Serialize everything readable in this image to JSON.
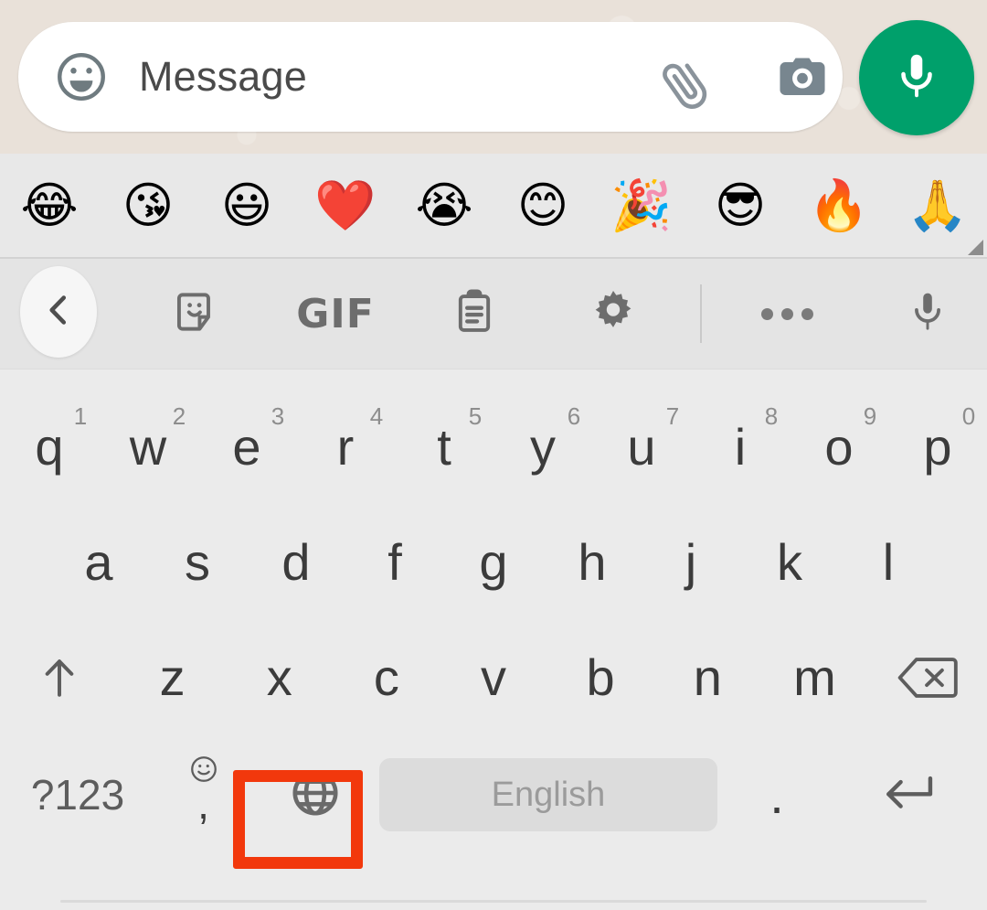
{
  "chat_input": {
    "emoji_icon": "smiley-face-icon",
    "placeholder": "Message",
    "attach_icon": "paperclip-icon",
    "camera_icon": "camera-icon",
    "voice_icon": "microphone-icon",
    "accent_green": "#00a06b",
    "background": "#e9e1d9"
  },
  "emoji_suggestions": {
    "items": [
      {
        "name": "face-with-tears-of-joy",
        "glyph": "😂"
      },
      {
        "name": "face-blowing-a-kiss",
        "glyph": "😘"
      },
      {
        "name": "grinning-face-with-big-eyes",
        "glyph": "😃"
      },
      {
        "name": "red-heart",
        "glyph": "❤️"
      },
      {
        "name": "loudly-crying-face",
        "glyph": "😭"
      },
      {
        "name": "smiling-face-with-smiling-eyes",
        "glyph": "😊"
      },
      {
        "name": "party-popper",
        "glyph": "🎉"
      },
      {
        "name": "smiling-face-with-sunglasses",
        "glyph": "😎"
      },
      {
        "name": "fire",
        "glyph": "🔥"
      },
      {
        "name": "folded-hands",
        "glyph": "🙏"
      }
    ],
    "resize_handle": "resize-handle-icon",
    "background": "#e8e8e8"
  },
  "toolbar": {
    "back_icon": "chevron-left-icon",
    "items": [
      {
        "name": "sticker-icon",
        "label": ""
      },
      {
        "name": "gif-icon",
        "label": "GIF"
      },
      {
        "name": "clipboard-icon",
        "label": ""
      },
      {
        "name": "settings-gear-icon",
        "label": ""
      },
      {
        "name": "more-options-icon",
        "label": ""
      },
      {
        "name": "voice-input-icon",
        "label": ""
      }
    ],
    "background": "#e4e4e4"
  },
  "keyboard": {
    "background": "#ebebeb",
    "row1": [
      {
        "key": "q",
        "hint": "1"
      },
      {
        "key": "w",
        "hint": "2"
      },
      {
        "key": "e",
        "hint": "3"
      },
      {
        "key": "r",
        "hint": "4"
      },
      {
        "key": "t",
        "hint": "5"
      },
      {
        "key": "y",
        "hint": "6"
      },
      {
        "key": "u",
        "hint": "7"
      },
      {
        "key": "i",
        "hint": "8"
      },
      {
        "key": "o",
        "hint": "9"
      },
      {
        "key": "p",
        "hint": "0"
      }
    ],
    "row2": [
      "a",
      "s",
      "d",
      "f",
      "g",
      "h",
      "j",
      "k",
      "l"
    ],
    "row3": {
      "shift_icon": "shift-arrow-up-icon",
      "keys": [
        "z",
        "x",
        "c",
        "v",
        "b",
        "n",
        "m"
      ],
      "backspace_icon": "backspace-delete-icon"
    },
    "row4": {
      "symbols_label": "?123",
      "comma_label": ",",
      "comma_emoji_icon": "smiley-face-icon",
      "language_switch_icon": "globe-language-icon",
      "spacebar_label": "English",
      "period_label": ".",
      "enter_icon": "enter-return-icon"
    }
  },
  "annotation": {
    "name": "globe-key-highlight",
    "color": "#f2380c",
    "target": "globe-language-icon"
  }
}
